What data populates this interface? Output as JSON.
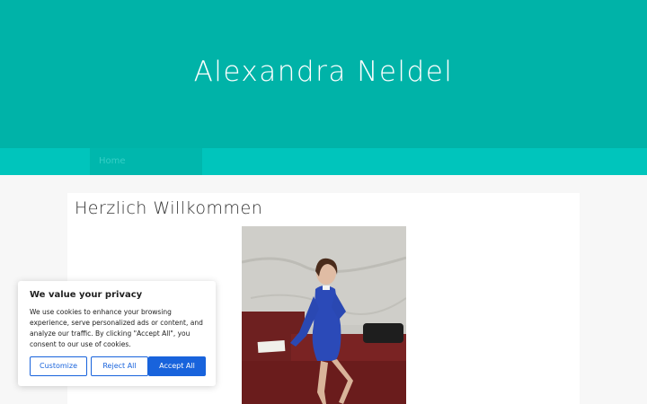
{
  "header": {
    "site_title": "Alexandra Neldel"
  },
  "nav": {
    "items": [
      {
        "label": "Home"
      }
    ]
  },
  "main": {
    "page_title": "Herzlich Willkommen"
  },
  "cookie": {
    "title": "We value your privacy",
    "text": "We use cookies to enhance your browsing experience, serve personalized ads or content, and analyze our traffic. By clicking \"Accept All\", you consent to our use of cookies.",
    "customize_label": "Customize",
    "reject_label": "Reject All",
    "accept_label": "Accept All"
  },
  "colors": {
    "header_bg": "#00b3a8",
    "nav_bg": "#00c5bc",
    "button_blue": "#1863dc"
  }
}
